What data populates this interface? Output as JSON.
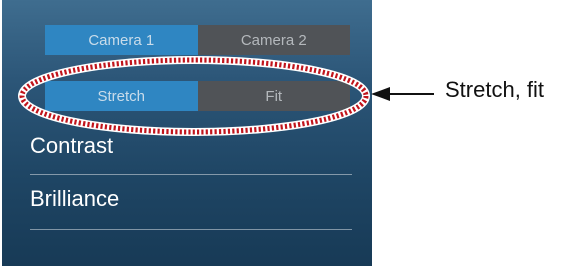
{
  "camera_toggle": {
    "options": [
      "Camera 1",
      "Camera 2"
    ],
    "selected": "Camera 1"
  },
  "display_toggle": {
    "options": [
      "Stretch",
      "Fit"
    ],
    "selected": "Stretch"
  },
  "menu": {
    "items": [
      {
        "label": "Contrast"
      },
      {
        "label": "Brilliance"
      }
    ]
  },
  "annotation": {
    "text": "Stretch, fit"
  },
  "colors": {
    "active_segment": "#2f86c2",
    "inactive_segment": "#505357",
    "callout_dots": "#c0141c"
  }
}
